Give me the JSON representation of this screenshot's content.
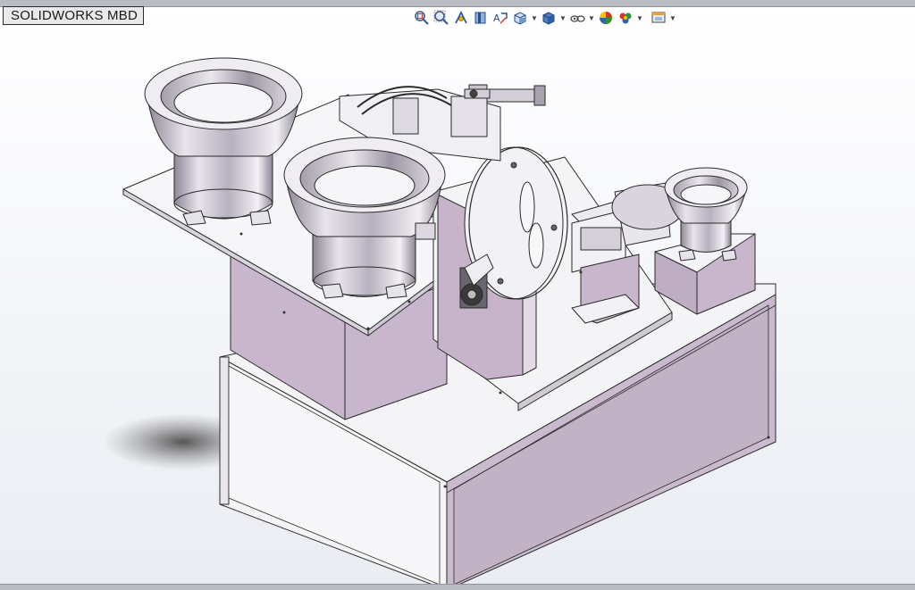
{
  "window": {
    "title": "SOLIDWORKS MBD"
  },
  "toolbar": {
    "items": [
      {
        "icon": "zoom-to-fit-icon"
      },
      {
        "icon": "zoom-to-area-icon"
      },
      {
        "icon": "previous-view-icon"
      },
      {
        "icon": "section-view-icon"
      },
      {
        "icon": "dynamic-annotation-views-icon"
      },
      {
        "icon": "view-orientation-icon",
        "has_dropdown": true
      },
      {
        "icon": "display-style-icon",
        "has_dropdown": true
      },
      {
        "icon": "hide-show-items-icon",
        "has_dropdown": true
      },
      {
        "icon": "edit-appearance-icon"
      },
      {
        "icon": "apply-scene-icon",
        "has_dropdown": true
      },
      {
        "icon": "view-settings-icon",
        "has_dropdown": true
      }
    ]
  },
  "colors": {
    "body_purple": "#c8b8cc",
    "body_white": "#f4f3f6",
    "outline": "#2a2a2a",
    "bowl_steel": "#b9b3c0",
    "background_top": "#ffffff",
    "background_bottom": "#e9ecf2"
  }
}
